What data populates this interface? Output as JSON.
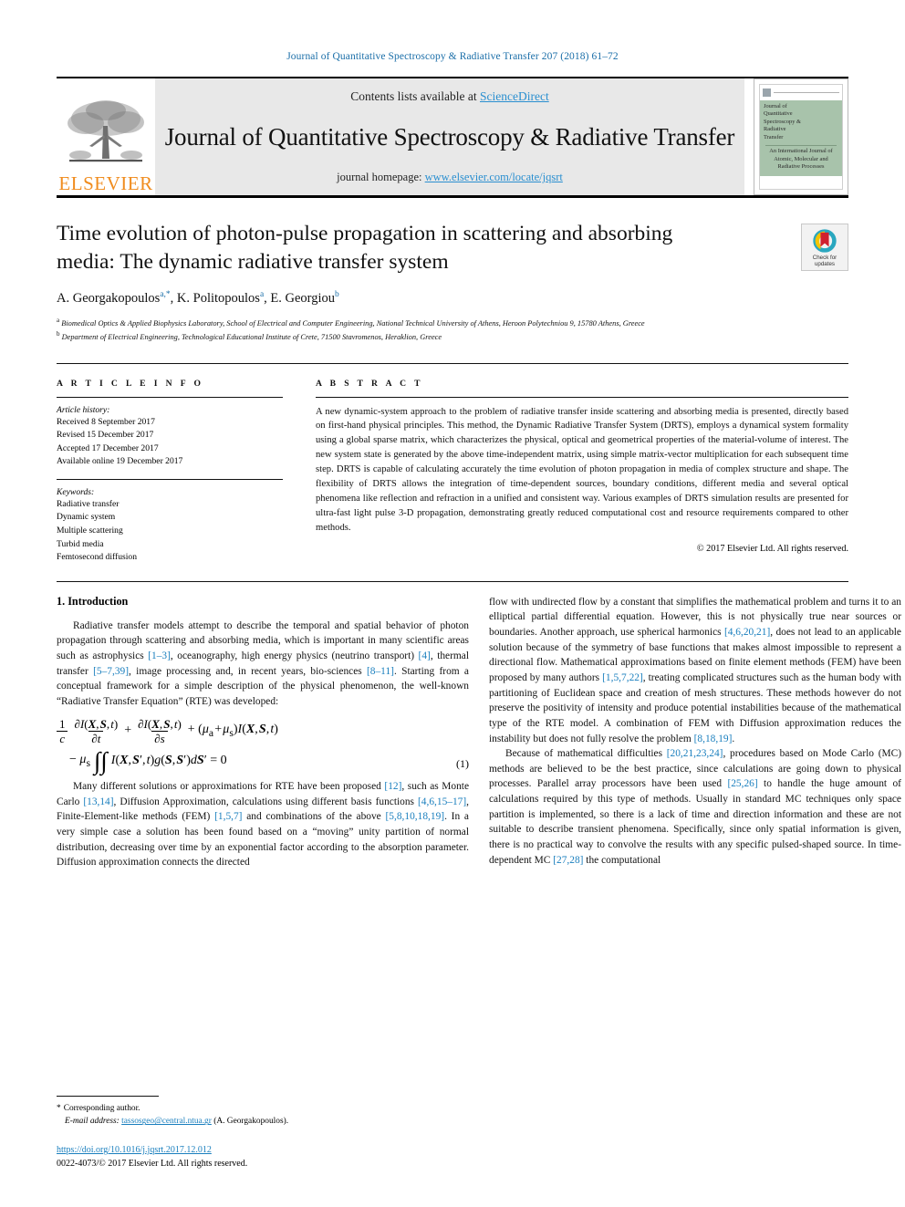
{
  "running_head": "Journal of Quantitative Spectroscopy & Radiative Transfer 207 (2018) 61–72",
  "masthead": {
    "contents_prefix": "Contents lists available at ",
    "sciencedirect": "ScienceDirect",
    "journal_title": "Journal of Quantitative Spectroscopy & Radiative Transfer",
    "homepage_prefix": "journal homepage: ",
    "homepage_url": "www.elsevier.com/locate/jqsrt",
    "publisher": "ELSEVIER",
    "cover": {
      "line1": "Journal of",
      "line2": "Quantitative",
      "line3": "Spectroscopy &",
      "line4": "Radiative",
      "line5": "Transfer",
      "footer": "An International Journal of Atomic, Molecular and Radiative Processes"
    }
  },
  "article": {
    "title": "Time evolution of photon-pulse propagation in scattering and absorbing media: The dynamic radiative transfer system",
    "crossmark_line1": "Check for",
    "crossmark_line2": "updates",
    "authors_html": "A. Georgakopoulos<sup>a,*</sup>, K. Politopoulos<sup>a</sup>, E. Georgiou<sup>b</sup>",
    "affiliation_a": "Biomedical Optics & Applied Biophysics Laboratory, School of Electrical and Computer Engineering, National Technical University of Athens, Heroon Polytechniou 9, 15780 Athens, Greece",
    "affiliation_b": "Department of Electrical Engineering, Technological Educational Institute of Crete, 71500 Stavromenos, Heraklion, Greece"
  },
  "info": {
    "heading": "A R T I C L E   I N F O",
    "history_label": "Article history:",
    "history": [
      "Received 8 September 2017",
      "Revised 15 December 2017",
      "Accepted 17 December 2017",
      "Available online 19 December 2017"
    ],
    "keywords_label": "Keywords:",
    "keywords": [
      "Radiative transfer",
      "Dynamic system",
      "Multiple scattering",
      "Turbid media",
      "Femtosecond diffusion"
    ]
  },
  "abstract": {
    "heading": "A B S T R A C T",
    "text": "A new dynamic-system approach to the problem of radiative transfer inside scattering and absorbing media is presented, directly based on first-hand physical principles. This method, the Dynamic Radiative Transfer System (DRTS), employs a dynamical system formality using a global sparse matrix, which characterizes the physical, optical and geometrical properties of the material-volume of interest. The new system state is generated by the above time-independent matrix, using simple matrix-vector multiplication for each subsequent time step. DRTS is capable of calculating accurately the time evolution of photon propagation in media of complex structure and shape. The flexibility of DRTS allows the integration of time-dependent sources, boundary conditions, different media and several optical phenomena like reflection and refraction in a unified and consistent way. Various examples of DRTS simulation results are presented for ultra-fast light pulse 3-D propagation, demonstrating greatly reduced computational cost and resource requirements compared to other methods.",
    "copyright": "© 2017 Elsevier Ltd. All rights reserved."
  },
  "body": {
    "section_title": "1. Introduction",
    "left_p1_a": "Radiative transfer models attempt to describe the temporal and spatial behavior of photon propagation through scattering and absorbing media, which is important in many scientific areas such as astrophysics ",
    "left_p1_r1": "[1–3]",
    "left_p1_b": ", oceanography, high energy physics (neutrino transport) ",
    "left_p1_r2": "[4]",
    "left_p1_c": ", thermal transfer ",
    "left_p1_r3": "[5–7,39]",
    "left_p1_d": ", image processing and, in recent years, bio-sciences ",
    "left_p1_r4": "[8–11]",
    "left_p1_e": ". Starting from a conceptual framework for a simple description of the physical phenomenon, the well-known “Radiative Transfer Equation” (RTE) was developed:",
    "equation_number": "(1)",
    "left_p2_a": "Many different solutions or approximations for RTE have been proposed ",
    "left_p2_r1": "[12]",
    "left_p2_b": ", such as Monte Carlo ",
    "left_p2_r2": "[13,14]",
    "left_p2_c": ", Diffusion Approximation, calculations using different basis functions ",
    "left_p2_r3": "[4,6,15–17]",
    "left_p2_d": ", Finite-Element-like methods (FEM) ",
    "left_p2_r4": "[1,5,7]",
    "left_p2_e": " and combinations of the above ",
    "left_p2_r5": "[5,8,10,18,19]",
    "left_p2_f": ". In a very simple case a solution has been found based on a “moving” unity partition of normal distribution, decreasing over time by an exponential factor according to the absorption parameter. Diffusion approximation connects the directed",
    "right_p1_a": "flow with undirected flow by a constant that simplifies the mathematical problem and turns it to an elliptical partial differential equation. However, this is not physically true near sources or boundaries. Another approach, use spherical harmonics ",
    "right_p1_r1": "[4,6,20,21]",
    "right_p1_b": ", does not lead to an applicable solution because of the symmetry of base functions that makes almost impossible to represent a directional flow. Mathematical approximations based on finite element methods (FEM) have been proposed by many authors ",
    "right_p1_r2": "[1,5,7,22]",
    "right_p1_c": ", treating complicated structures such as the human body with partitioning of Euclidean space and creation of mesh structures. These methods however do not preserve the positivity of intensity and produce potential instabilities because of the mathematical type of the RTE model. A combination of FEM with Diffusion approximation reduces the instability but does not fully resolve the problem ",
    "right_p1_r3": "[8,18,19]",
    "right_p1_d": ".",
    "right_p2_a": "Because of mathematical difficulties ",
    "right_p2_r1": "[20,21,23,24]",
    "right_p2_b": ", procedures based on Mode Carlo (MC) methods are believed to be the best practice, since calculations are going down to physical processes. Parallel array processors have been used ",
    "right_p2_r2": "[25,26]",
    "right_p2_c": " to handle the huge amount of calculations required by this type of methods. Usually in standard MC techniques only space partition is implemented, so there is a lack of time and direction information and these are not suitable to describe transient phenomena. Specifically, since only spatial information is given, there is no practical way to convolve the results with any specific pulsed-shaped source. In time-dependent MC ",
    "right_p2_r3": "[27,28]",
    "right_p2_d": " the computational"
  },
  "footnotes": {
    "corresponding": "Corresponding author.",
    "email_label": "E-mail address:",
    "email": "tassosgeo@central.ntua.gr",
    "email_suffix": "(A. Georgakopoulos).",
    "doi": "https://doi.org/10.1016/j.jqsrt.2017.12.012",
    "issn_line": "0022-4073/© 2017 Elsevier Ltd. All rights reserved."
  },
  "colors": {
    "link": "#1a7fbe",
    "sciencedirect": "#2a8fd0",
    "elsevier_orange": "#F08C1E",
    "cover_band": "#a8c3ab"
  }
}
